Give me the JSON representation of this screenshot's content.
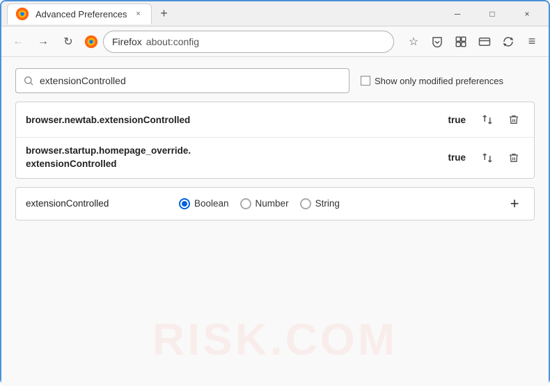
{
  "window": {
    "title": "Advanced Preferences",
    "tab_close": "×",
    "new_tab": "+",
    "min_btn": "─",
    "max_btn": "□",
    "close_btn": "×"
  },
  "nav": {
    "back_label": "←",
    "forward_label": "→",
    "reload_label": "↻",
    "browser_name": "Firefox",
    "url": "about:config",
    "bookmark_icon": "☆",
    "pocket_icon": "⬡",
    "extension_icon": "⬒",
    "profile_icon": "⬭",
    "sync_icon": "⟳",
    "menu_icon": "≡"
  },
  "search": {
    "placeholder": "extensionControlled",
    "value": "extensionControlled",
    "modified_label": "Show only modified preferences"
  },
  "results": [
    {
      "name": "browser.newtab.extensionControlled",
      "value": "true"
    },
    {
      "name": "browser.startup.homepage_override.\nextensionControlled",
      "name_line1": "browser.startup.homepage_override.",
      "name_line2": "extensionControlled",
      "value": "true",
      "multiline": true
    }
  ],
  "add_row": {
    "name": "extensionControlled",
    "type_options": [
      "Boolean",
      "Number",
      "String"
    ],
    "selected_type": "Boolean",
    "add_icon": "+"
  },
  "watermark": "RISK.COM"
}
